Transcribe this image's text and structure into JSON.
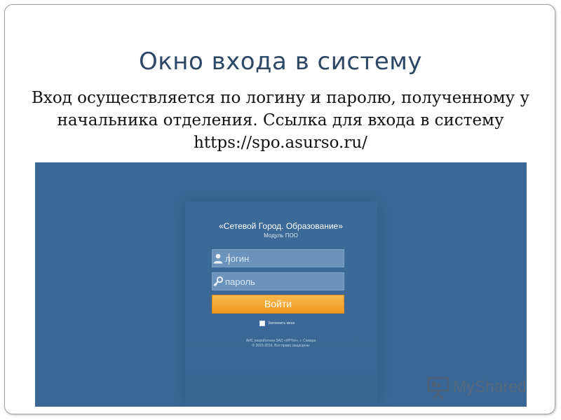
{
  "slide": {
    "title": "Окно входа в систему",
    "body_lines": [
      "Вход осуществляется по логину и паролю, полученному у",
      "начальника отделения. Ссылка для входа в систему",
      "https://spo.asurso.ru/"
    ]
  },
  "login_app": {
    "title": "«Сетевой Город. Образование»",
    "subtitle": "Модуль ПОО",
    "login_placeholder": "логин",
    "password_placeholder": "пароль",
    "login_button": "Войти",
    "remember_label": "Запомнить меня",
    "footer_line1": "АИС разработана ЗАО «ИРТех», г. Самара",
    "footer_line2": "© 2015-2016. Все права защищены"
  },
  "watermark": {
    "text": "MyShared"
  },
  "colors": {
    "screenshot_bg": "#3a6795",
    "button_orange": "#f09a1f",
    "title_blue": "#2d4865"
  },
  "icons": {
    "login_field": "user-icon",
    "password_field": "key-icon",
    "watermark": "presentation-icon"
  }
}
